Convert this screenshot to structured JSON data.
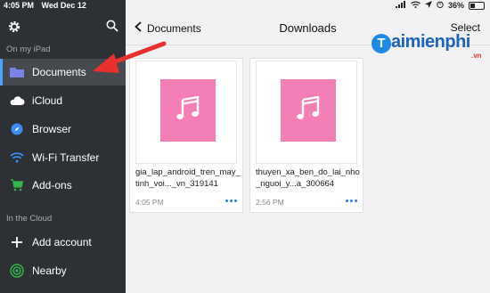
{
  "status_bar": {
    "time": "4:05 PM",
    "date": "Wed Dec 12",
    "battery": "36%",
    "battery_level": 0.36
  },
  "sidebar": {
    "section_ipad": "On my iPad",
    "section_cloud": "In the Cloud",
    "items": [
      {
        "label": "Documents",
        "icon": "folder-icon",
        "color": "#7a82e6"
      },
      {
        "label": "iCloud",
        "icon": "cloud-icon",
        "color": "#ffffff"
      },
      {
        "label": "Browser",
        "icon": "compass-icon",
        "color": "#3b8df5"
      },
      {
        "label": "Wi-Fi Transfer",
        "icon": "wifi-icon",
        "color": "#3b8df5"
      },
      {
        "label": "Add-ons",
        "icon": "cart-icon",
        "color": "#36b44a"
      }
    ],
    "cloud_items": [
      {
        "label": "Add account",
        "icon": "plus-icon"
      },
      {
        "label": "Nearby",
        "icon": "nearby-icon",
        "color": "#36b44a"
      }
    ]
  },
  "main": {
    "back_label": "Documents",
    "title": "Downloads",
    "select_label": "Select",
    "files": [
      {
        "name": "gia_lap_android_tren_may_tinh_voi..._vn_319141",
        "time": "4:05 PM"
      },
      {
        "name": "thuyen_xa_ben_do_lai_nho_nguoi_y...a_300664",
        "time": "2:56 PM"
      }
    ]
  },
  "watermark": {
    "letter": "T",
    "text": "aimienphi",
    "suffix": ".vn"
  },
  "colors": {
    "sidebar_bg": "#2d3034",
    "active_item": "#46494e",
    "thumb_pink": "#f47eb6",
    "arrow_red": "#e8312f",
    "accent_blue": "#2f7fe0"
  }
}
